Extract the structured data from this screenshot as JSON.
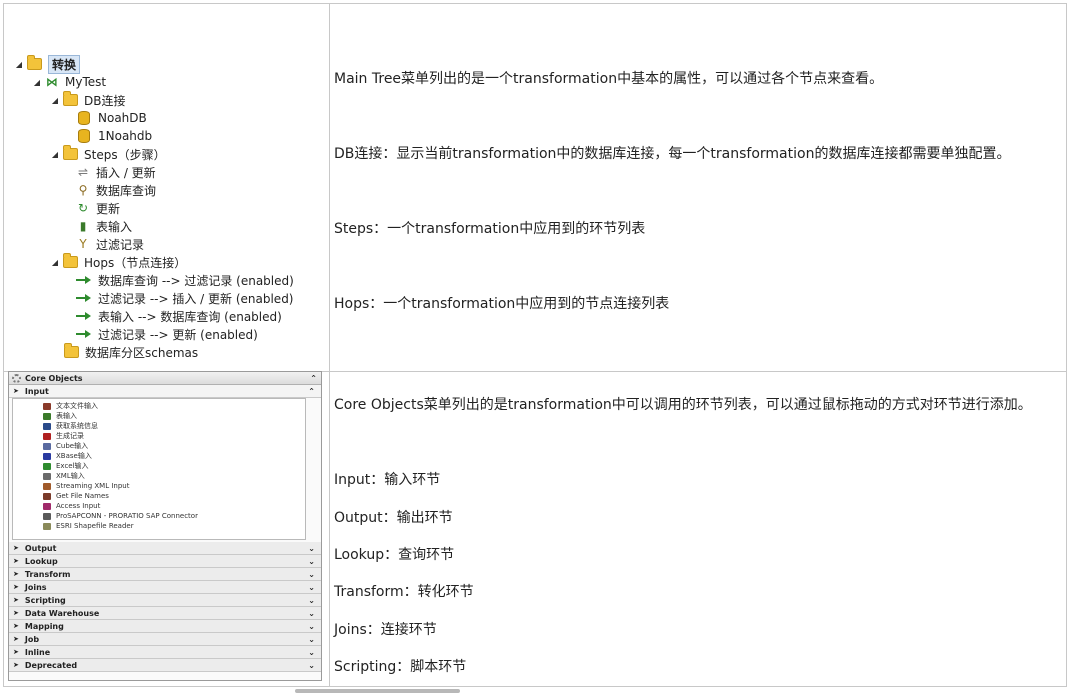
{
  "tree": {
    "root": "转换",
    "transformation": "MyTest",
    "db_folder": "DB连接",
    "db_items": [
      "NoahDB",
      "1Noahdb"
    ],
    "steps_folder": "Steps（步骤）",
    "steps_items": [
      "插入 / 更新",
      "数据库查询",
      "更新",
      "表输入",
      "过滤记录"
    ],
    "hops_folder": "Hops（节点连接）",
    "hops_items": [
      "数据库查询 --> 过滤记录 (enabled)",
      "过滤记录 --> 插入 / 更新 (enabled)",
      "表输入 --> 数据库查询 (enabled)",
      "过滤记录 --> 更新 (enabled)"
    ],
    "partial_item": "数据库分区schemas"
  },
  "descriptions_top": [
    "Main Tree菜单列出的是一个transformation中基本的属性，可以通过各个节点来查看。",
    "DB连接：显示当前transformation中的数据库连接，每一个transformation的数据库连接都需要单独配置。",
    "Steps：一个transformation中应用到的环节列表",
    "Hops：一个transformation中应用到的节点连接列表"
  ],
  "core": {
    "title": "Core Objects",
    "input_label": "Input",
    "input_items": [
      "文本文件输入",
      "表输入",
      "获取系统信息",
      "生成记录",
      "Cube输入",
      "XBase输入",
      "Excel输入",
      "XML输入",
      "Streaming XML Input",
      "Get File Names",
      "Access Input",
      "ProSAPCONN - PRORATIO SAP Connector",
      "ESRI Shapefile Reader"
    ],
    "categories": [
      "Output",
      "Lookup",
      "Transform",
      "Joins",
      "Scripting",
      "Data Warehouse",
      "Mapping",
      "Job",
      "Inline",
      "Deprecated"
    ]
  },
  "descriptions_bottom": [
    "Core Objects菜单列出的是transformation中可以调用的环节列表，可以通过鼠标拖动的方式对环节进行添加。",
    "Input：输入环节",
    "Output：输出环节",
    "Lookup：查询环节",
    "Transform：转化环节",
    "Joins：连接环节",
    "Scripting：脚本环节"
  ],
  "colors": {
    "folder": "#f3c33a",
    "hop_arrow": "#2e8b2e",
    "selection": "#d8e6f6"
  }
}
